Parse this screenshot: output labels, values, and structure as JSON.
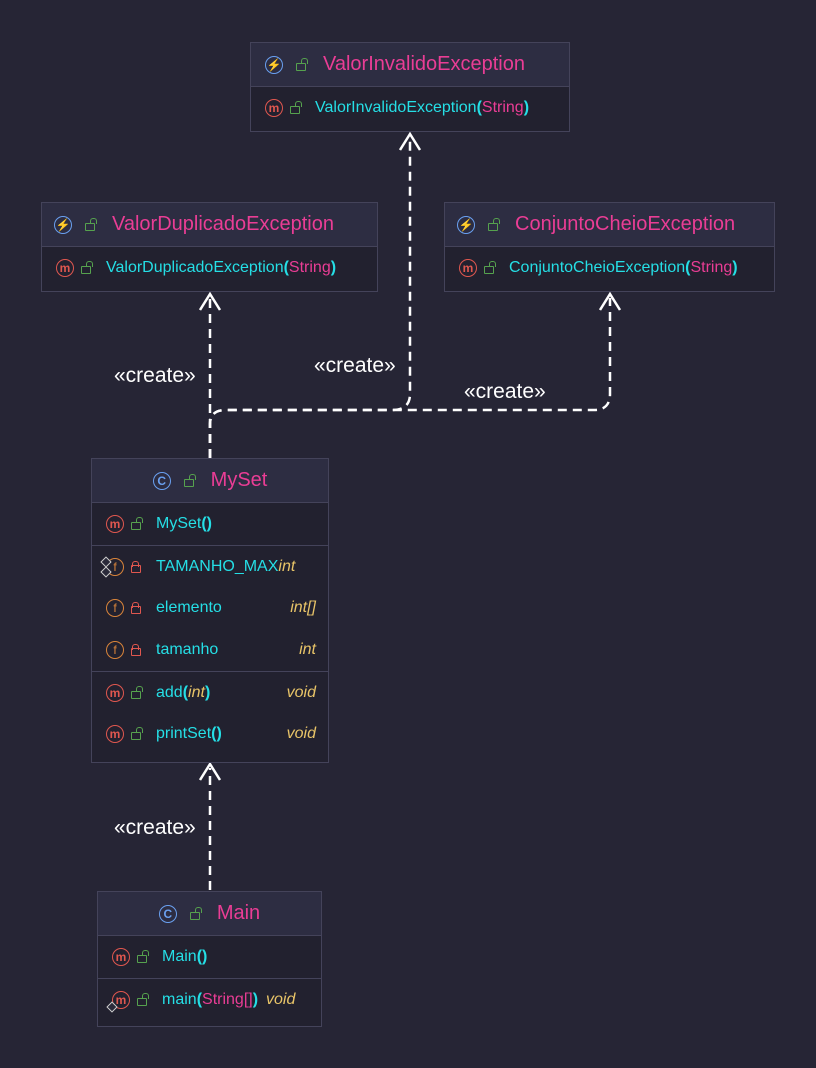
{
  "labels": {
    "create_1": "«create»",
    "create_2": "«create»",
    "create_3": "«create»",
    "create_4": "«create»"
  },
  "valor_invalido": {
    "title": "ValorInvalidoException",
    "ctor_name": "ValorInvalidoException",
    "ctor_param": "String"
  },
  "valor_duplicado": {
    "title": "ValorDuplicadoException",
    "ctor_name": "ValorDuplicadoException",
    "ctor_param": "String"
  },
  "conjunto_cheio": {
    "title": "ConjuntoCheioException",
    "ctor_name": "ConjuntoCheioException",
    "ctor_param": "String"
  },
  "myset": {
    "title": "MySet",
    "ctor_name": "MySet",
    "fields": [
      {
        "name": "TAMANHO_MAX",
        "type": "int"
      },
      {
        "name": "elemento",
        "type": "int[]"
      },
      {
        "name": "tamanho",
        "type": "int"
      }
    ],
    "methods": [
      {
        "name": "add",
        "param": "int",
        "ret": "void"
      },
      {
        "name": "printSet",
        "ret": "void"
      }
    ]
  },
  "main": {
    "title": "Main",
    "ctor_name": "Main",
    "method_name": "main",
    "method_param": "String[]",
    "method_ret": "void"
  },
  "colors": {
    "background": "#262535",
    "title": "#ea3d95",
    "member": "#25dfe6",
    "type": "#e8c468",
    "edge": "#ffffff"
  },
  "icons": [
    "exception-class-icon",
    "class-icon",
    "main-class-icon",
    "method-icon",
    "field-icon",
    "public-lock-icon",
    "private-lock-icon",
    "static-marker-icon"
  ]
}
